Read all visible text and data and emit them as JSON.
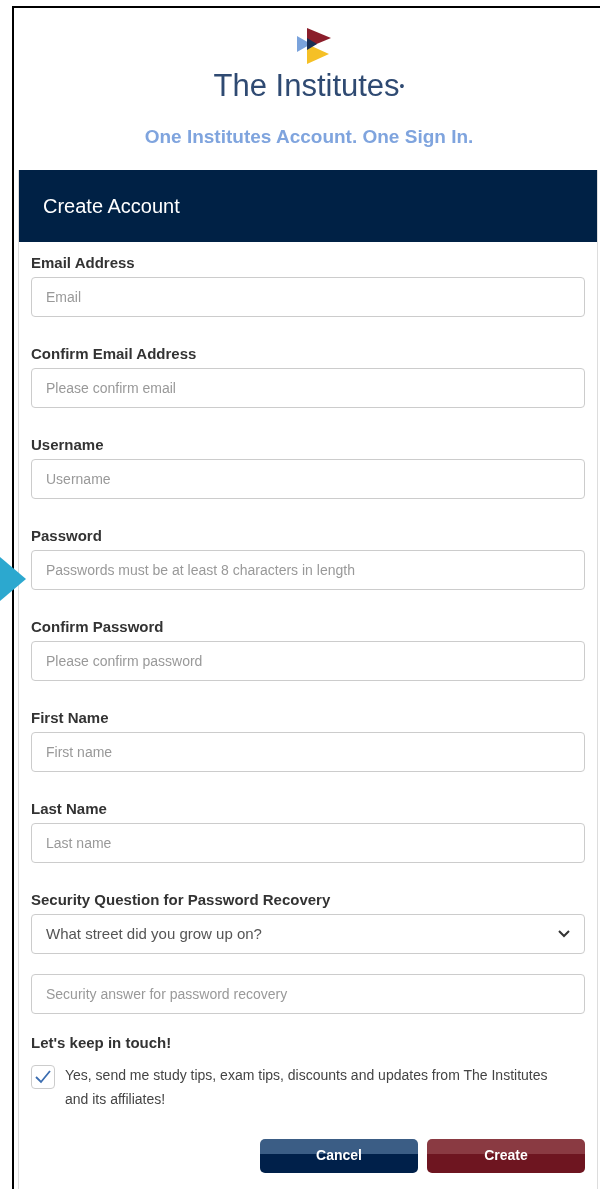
{
  "logo": {
    "name": "The Institutes",
    "mark": "•"
  },
  "tagline": "One Institutes Account. One Sign In.",
  "header": {
    "title": "Create Account"
  },
  "fields": [
    {
      "kind": "text",
      "label": "Email Address",
      "placeholder": "Email"
    },
    {
      "kind": "text",
      "label": "Confirm Email Address",
      "placeholder": "Please confirm email"
    },
    {
      "kind": "text",
      "label": "Username",
      "placeholder": "Username"
    },
    {
      "kind": "text",
      "label": "Password",
      "placeholder": "Passwords must be at least 8 characters in length",
      "pointed": true
    },
    {
      "kind": "text",
      "label": "Confirm Password",
      "placeholder": "Please confirm password"
    },
    {
      "kind": "text",
      "label": "First Name",
      "placeholder": "First name"
    },
    {
      "kind": "text",
      "label": "Last Name",
      "placeholder": "Last name"
    },
    {
      "kind": "select",
      "label": "Security Question for Password Recovery",
      "value": "What street did you grow up on?"
    },
    {
      "kind": "text",
      "placeholder": "Security answer for password recovery"
    }
  ],
  "newsletter": {
    "heading": "Let's keep in touch!",
    "label": "Yes, send me study tips, exam tips, discounts and updates from The Institutes and its affiliates!",
    "checked": true
  },
  "buttons": [
    {
      "kind": "secondary",
      "label": "Cancel"
    },
    {
      "kind": "primary",
      "label": "Create"
    }
  ]
}
